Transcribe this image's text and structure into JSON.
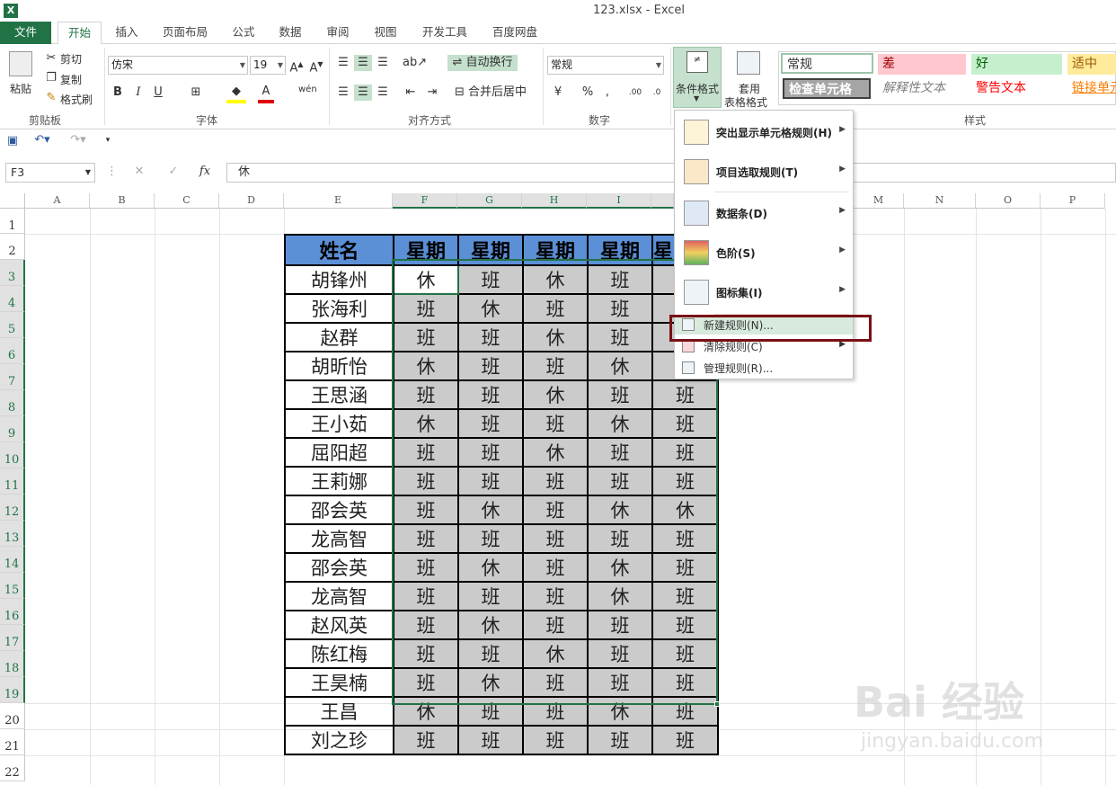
{
  "window": {
    "title": "123.xlsx - Excel",
    "app_logo": "X"
  },
  "tabs": [
    {
      "label": "文件",
      "kind": "file"
    },
    {
      "label": "开始",
      "kind": "active"
    },
    {
      "label": "插入"
    },
    {
      "label": "页面布局"
    },
    {
      "label": "公式"
    },
    {
      "label": "数据"
    },
    {
      "label": "审阅"
    },
    {
      "label": "视图"
    },
    {
      "label": "开发工具"
    },
    {
      "label": "百度网盘"
    }
  ],
  "ribbon": {
    "clipboard": {
      "paste": "粘贴",
      "cut": "剪切",
      "copy": "复制",
      "format_painter": "格式刷",
      "label": "剪贴板"
    },
    "font": {
      "name": "仿宋",
      "size": "19",
      "bold": "B",
      "italic": "I",
      "underline": "U",
      "wen": "wén",
      "label": "字体"
    },
    "alignment": {
      "wrap": "自动换行",
      "merge": "合并后居中",
      "label": "对齐方式"
    },
    "number": {
      "format": "常规",
      "percent": "%",
      "comma": ",",
      "label": "数字"
    },
    "styles": {
      "conditional": "条件格式",
      "table_format_1": "套用",
      "table_format_2": "表格格式",
      "cells": [
        {
          "label": "常规",
          "bg": "#ffffff",
          "color": "#000000"
        },
        {
          "label": "差",
          "bg": "#ffc7ce",
          "color": "#9c0006"
        },
        {
          "label": "好",
          "bg": "#c6efce",
          "color": "#006100"
        },
        {
          "label": "适中",
          "bg": "#ffeb9c",
          "color": "#9c5700"
        },
        {
          "label": "检查单元格",
          "bg": "#a5a5a5",
          "color": "#ffffff"
        },
        {
          "label": "解释性文本",
          "bg": "#ffffff",
          "color": "#7f7f7f"
        },
        {
          "label": "警告文本",
          "bg": "#ffffff",
          "color": "#ff0000"
        },
        {
          "label": "链接单元",
          "bg": "#ffffff",
          "color": "#fa7d00"
        }
      ],
      "label": "样式"
    }
  },
  "formula_bar": {
    "name_box": "F3",
    "fx": "fx",
    "value": "休"
  },
  "columns": [
    "A",
    "B",
    "C",
    "D",
    "E",
    "F",
    "G",
    "H",
    "I",
    "",
    "",
    "",
    "M",
    "N",
    "O",
    "P"
  ],
  "rows": [
    "1",
    "2",
    "3",
    "4",
    "5",
    "6",
    "7",
    "8",
    "9",
    "10",
    "11",
    "12",
    "13",
    "14",
    "15",
    "16",
    "17",
    "18",
    "19",
    "20",
    "21",
    "22"
  ],
  "table": {
    "header": [
      "姓名",
      "星期",
      "星期",
      "星期",
      "星期",
      "星"
    ],
    "rows": [
      [
        "胡锋州",
        "休",
        "班",
        "休",
        "班",
        ""
      ],
      [
        "张海利",
        "班",
        "休",
        "班",
        "班",
        ""
      ],
      [
        "赵群",
        "班",
        "班",
        "休",
        "班",
        ""
      ],
      [
        "胡昕怡",
        "休",
        "班",
        "班",
        "休",
        ""
      ],
      [
        "王思涵",
        "班",
        "班",
        "休",
        "班",
        "班"
      ],
      [
        "王小茹",
        "休",
        "班",
        "班",
        "休",
        "班"
      ],
      [
        "屈阳超",
        "班",
        "班",
        "休",
        "班",
        "班"
      ],
      [
        "王莉娜",
        "班",
        "班",
        "班",
        "班",
        "班"
      ],
      [
        "邵会英",
        "班",
        "休",
        "班",
        "休",
        "休"
      ],
      [
        "龙高智",
        "班",
        "班",
        "班",
        "班",
        "班"
      ],
      [
        "邵会英",
        "班",
        "休",
        "班",
        "休",
        "班"
      ],
      [
        "龙高智",
        "班",
        "班",
        "班",
        "休",
        "班"
      ],
      [
        "赵风英",
        "班",
        "休",
        "班",
        "班",
        "班"
      ],
      [
        "陈红梅",
        "班",
        "班",
        "休",
        "班",
        "班"
      ],
      [
        "王昊楠",
        "班",
        "休",
        "班",
        "班",
        "班"
      ],
      [
        "王昌",
        "休",
        "班",
        "班",
        "休",
        "班"
      ],
      [
        "刘之珍",
        "班",
        "班",
        "班",
        "班",
        "班"
      ]
    ]
  },
  "menu": {
    "items": [
      {
        "label": "突出显示单元格规则(H)"
      },
      {
        "label": "项目选取规则(T)"
      },
      {
        "label": "数据条(D)"
      },
      {
        "label": "色阶(S)"
      },
      {
        "label": "图标集(I)"
      }
    ],
    "small_items": [
      {
        "label": "新建规则(N)..."
      },
      {
        "label": "清除规则(C)"
      },
      {
        "label": "管理规则(R)..."
      }
    ]
  },
  "watermark": {
    "brand": "Bai 经验",
    "url": "jingyan.baidu.com"
  }
}
